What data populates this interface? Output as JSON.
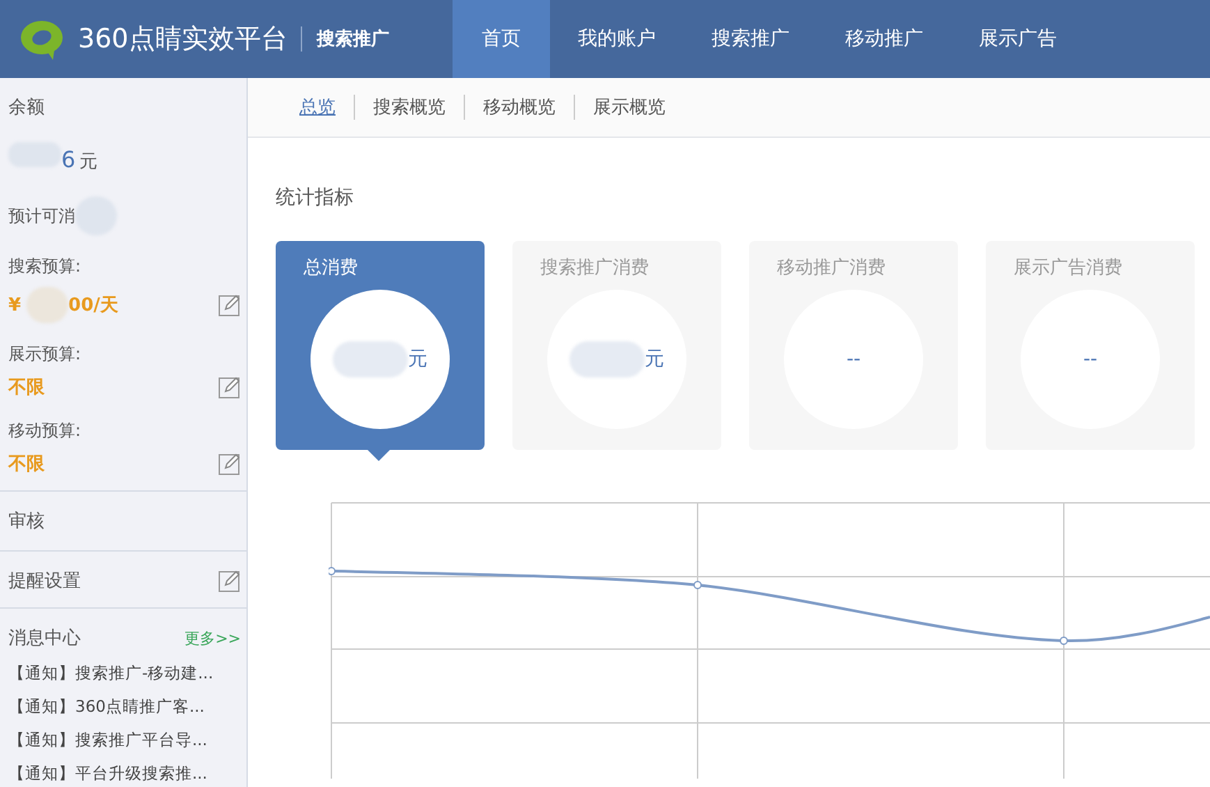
{
  "header": {
    "title": "360点睛实效平台",
    "product": "搜索推广",
    "nav": [
      {
        "label": "首页",
        "selected": true
      },
      {
        "label": "我的账户",
        "selected": false
      },
      {
        "label": "搜索推广",
        "selected": false
      },
      {
        "label": "移动推广",
        "selected": false
      },
      {
        "label": "展示广告",
        "selected": false
      }
    ]
  },
  "sidebar": {
    "balance": {
      "label": "余额",
      "value": "6",
      "unit": "元",
      "forecast": "预计可消"
    },
    "budgets": [
      {
        "label": "搜索预算:",
        "prefix": "¥",
        "value": "00/天"
      },
      {
        "label": "展示预算:",
        "value": "不限"
      },
      {
        "label": "移动预算:",
        "value": "不限"
      }
    ],
    "review": "审核",
    "reminder": "提醒设置",
    "messages": {
      "title": "消息中心",
      "more": "更多>>",
      "items": [
        "【通知】搜索推广-移动建...",
        "【通知】360点睛推广客...",
        "【通知】搜索推广平台导...",
        "【通知】平台升级搜索推..."
      ]
    }
  },
  "subnav": [
    {
      "label": "总览",
      "selected": true
    },
    {
      "label": "搜索概览",
      "selected": false
    },
    {
      "label": "移动概览",
      "selected": false
    },
    {
      "label": "展示概览",
      "selected": false
    }
  ],
  "section_title": "统计指标",
  "cards": [
    {
      "title": "总消费",
      "unit": "元",
      "selected": true
    },
    {
      "title": "搜索推广消费",
      "unit": "元",
      "selected": false
    },
    {
      "title": "移动推广消费",
      "value": "--",
      "selected": false
    },
    {
      "title": "展示广告消费",
      "value": "--",
      "selected": false
    }
  ]
}
